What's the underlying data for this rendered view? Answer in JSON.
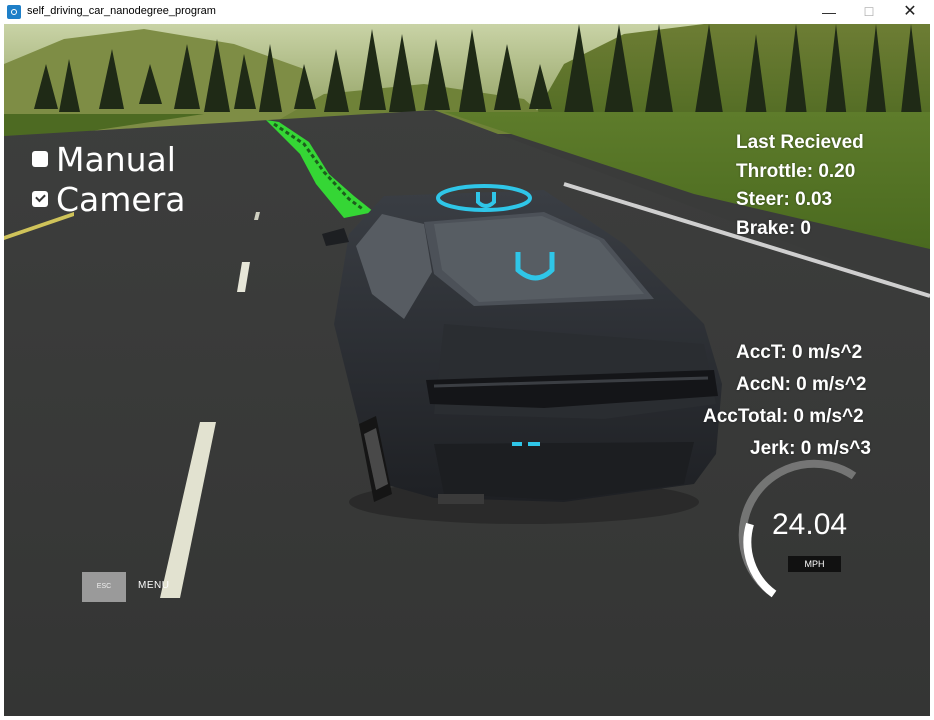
{
  "window": {
    "title": "self_driving_car_nanodegree_program",
    "minimize_icon": "minimize-icon",
    "maximize_icon": "maximize-icon",
    "close_icon": "close-icon"
  },
  "controls": {
    "manual": {
      "label": "Manual",
      "checked": false
    },
    "camera": {
      "label": "Camera",
      "checked": true
    }
  },
  "telemetry": {
    "header": "Last Recieved",
    "throttle": "Throttle: 0.20",
    "steer": "Steer: 0.03",
    "brake": "Brake: 0"
  },
  "dynamics": {
    "acc_t": "AccT: 0 m/s^2",
    "acc_n": "AccN: 0 m/s^2",
    "acc_total": "AccTotal: 0 m/s^2",
    "jerk": "Jerk: 0 m/s^3"
  },
  "menu": {
    "esc_label": "ESC",
    "menu_label": "MENU"
  },
  "speedometer": {
    "value": "24.04",
    "unit": "MPH",
    "fill_fraction": 0.45
  },
  "colors": {
    "path_green": "#35d635",
    "car_body": "#2b2e33",
    "logo_cyan": "#2fc6e8",
    "grass": "#5d7a2c",
    "road": "#3c3d3c"
  }
}
